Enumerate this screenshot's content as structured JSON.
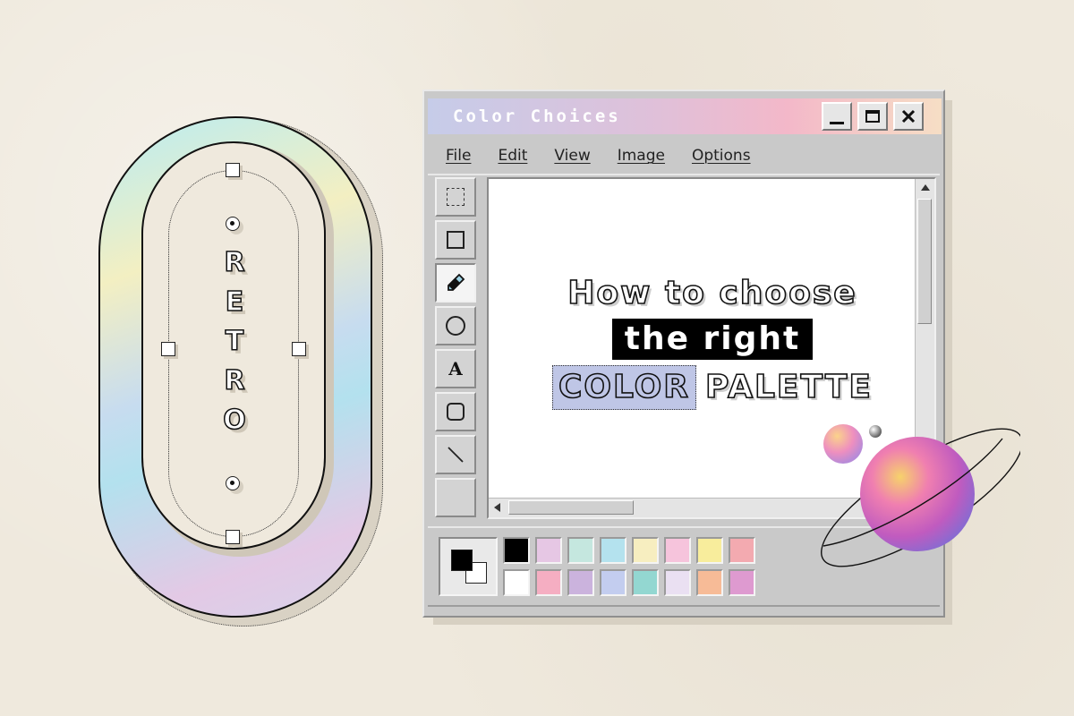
{
  "window": {
    "title": "Color Choices",
    "menu": [
      "File",
      "Edit",
      "View",
      "Image",
      "Options"
    ]
  },
  "tools": [
    {
      "name": "select-tool",
      "icon": "dashed-select-icon",
      "active": false
    },
    {
      "name": "rectangle-tool",
      "icon": "rectangle-icon",
      "active": false
    },
    {
      "name": "pen-tool",
      "icon": "pen-icon",
      "active": true
    },
    {
      "name": "ellipse-tool",
      "icon": "circle-icon",
      "active": false
    },
    {
      "name": "text-tool",
      "icon": "text-icon",
      "label": "A",
      "active": false
    },
    {
      "name": "rounded-rect-tool",
      "icon": "rounded-rect-icon",
      "active": false
    },
    {
      "name": "line-tool",
      "icon": "line-icon",
      "active": false
    },
    {
      "name": "blank-tool",
      "icon": "",
      "active": false
    }
  ],
  "canvas": {
    "line1": "How to choose",
    "line2": "the right",
    "line3_word1": "COLOR",
    "line3_word2": "PALETTE"
  },
  "retro": {
    "letters": [
      "R",
      "E",
      "T",
      "R",
      "O"
    ]
  },
  "palette": {
    "foreground": "#000000",
    "background": "#ffffff",
    "colors": [
      "#000000",
      "#e6c7e4",
      "#c5e7df",
      "#b4e2ee",
      "#f7eec0",
      "#f6c4dc",
      "#f8ed9c",
      "#f3aab0",
      "#ffffff",
      "#f5aec2",
      "#cbb3dd",
      "#c3cdef",
      "#93d7d1",
      "#eae0f2",
      "#f7bb97",
      "#de9ad0"
    ]
  },
  "colors": {
    "background": "#efe9dd",
    "window_chrome": "#c9c9c9",
    "highlight_word": "#bfc6e6"
  }
}
